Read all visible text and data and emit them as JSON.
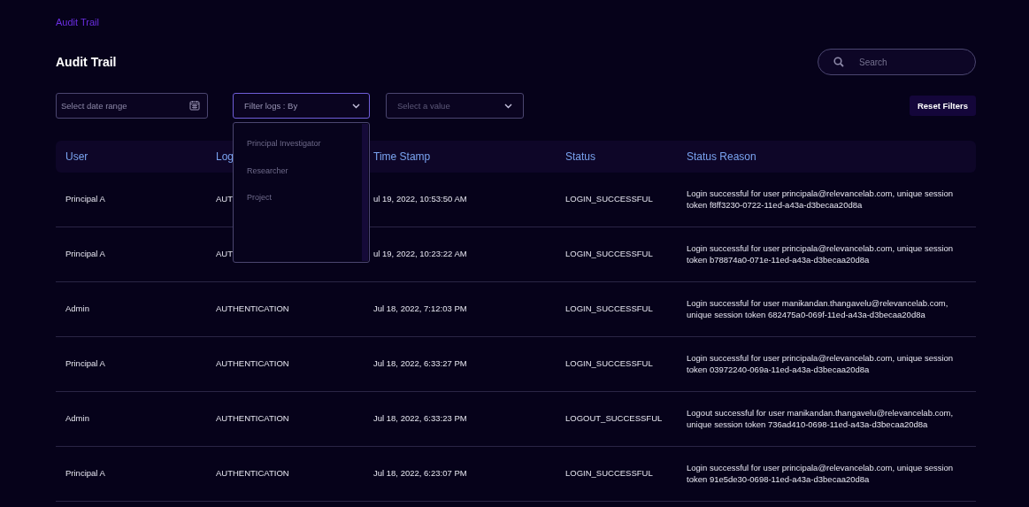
{
  "breadcrumb": "Audit Trail",
  "title": "Audit Trail",
  "search": {
    "placeholder": "Search"
  },
  "filters": {
    "date_range": {
      "placeholder": "Select date range"
    },
    "filter_by": {
      "value": "Filter logs : By",
      "open": true,
      "options": [
        {
          "label": "Principal Investigator",
          "selected": false
        },
        {
          "label": "Researcher",
          "selected": false
        },
        {
          "label": "Project",
          "selected": false
        }
      ]
    },
    "value_select": {
      "placeholder": "Select a value"
    },
    "reset_button": "Reset Filters"
  },
  "table": {
    "columns": [
      "User",
      "Log",
      "Time Stamp",
      "Status",
      "Status Reason"
    ],
    "rows": [
      [
        "Principal A",
        "AUT",
        "ul 19, 2022, 10:53:50 AM",
        "LOGIN_SUCCESSFUL",
        "Login successful for user principala@relevancelab.com, unique session token f8ff3230-0722-11ed-a43a-d3becaa20d8a"
      ],
      [
        "Principal A",
        "AUT",
        "ul 19, 2022, 10:23:22 AM",
        "LOGIN_SUCCESSFUL",
        "Login successful for user principala@relevancelab.com, unique session token b78874a0-071e-11ed-a43a-d3becaa20d8a"
      ],
      [
        "Admin",
        "AUTHENTICATION",
        "Jul 18, 2022, 7:12:03 PM",
        "LOGIN_SUCCESSFUL",
        "Login successful for user manikandan.thangavelu@relevancelab.com, unique session token 682475a0-069f-11ed-a43a-d3becaa20d8a"
      ],
      [
        "Principal A",
        "AUTHENTICATION",
        "Jul 18, 2022, 6:33:27 PM",
        "LOGIN_SUCCESSFUL",
        "Login successful for user principala@relevancelab.com, unique session token 03972240-069a-11ed-a43a-d3becaa20d8a"
      ],
      [
        "Admin",
        "AUTHENTICATION",
        "Jul 18, 2022, 6:33:23 PM",
        "LOGOUT_SUCCESSFUL",
        "Logout successful for user manikandan.thangavelu@relevancelab.com, unique session token 736ad410-0698-11ed-a43a-d3becaa20d8a"
      ],
      [
        "Principal A",
        "AUTHENTICATION",
        "Jul 18, 2022, 6:23:07 PM",
        "LOGIN_SUCCESSFUL",
        "Login successful for user principala@relevancelab.com, unique session token 91e5de30-0698-11ed-a43a-d3becaa20d8a"
      ]
    ]
  }
}
